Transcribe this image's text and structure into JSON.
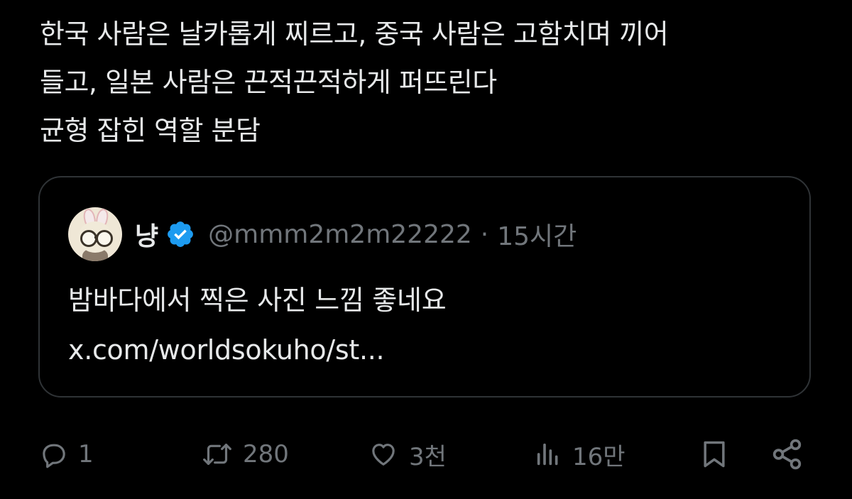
{
  "tweet": {
    "text_lines": [
      "한국 사람은 날카롭게 찌르고, 중국 사람은 고함치며 끼어",
      "들고, 일본 사람은 끈적끈적하게 퍼뜨린다",
      "균형 잡힌 역할 분담"
    ]
  },
  "quote": {
    "author_name": "냥",
    "verified": true,
    "handle": "@mmm2m2m22222",
    "separator": "·",
    "time": "15시간",
    "text_lines": [
      "밤바다에서 찍은 사진 느낌 좋네요",
      "x.com/worldsokuho/st..."
    ]
  },
  "actions": {
    "reply": {
      "icon": "reply-icon",
      "count": "1"
    },
    "retweet": {
      "icon": "retweet-icon",
      "count": "280"
    },
    "like": {
      "icon": "heart-icon",
      "count": "3천"
    },
    "views": {
      "icon": "views-chart-icon",
      "count": "16만"
    },
    "bookmark": {
      "icon": "bookmark-icon"
    },
    "share": {
      "icon": "share-icon"
    }
  },
  "colors": {
    "background": "#000000",
    "text": "#e7e9ea",
    "muted": "#71767b",
    "border": "#2f3336",
    "verified": "#1d9bf0"
  }
}
